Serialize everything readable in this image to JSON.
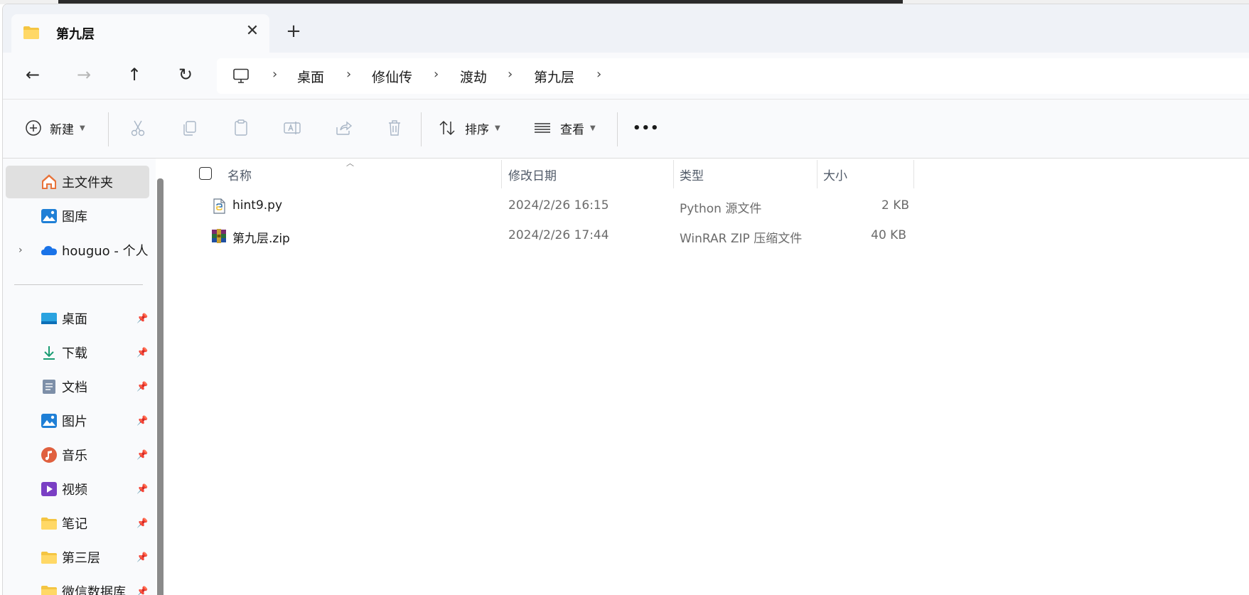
{
  "window": {
    "tab_title": "第九层",
    "new_tab": "+",
    "close": "✕"
  },
  "nav": {
    "back": "←",
    "forward": "→",
    "up": "↑",
    "refresh": "↻"
  },
  "breadcrumb": [
    "桌面",
    "修仙传",
    "渡劫",
    "第九层"
  ],
  "breadcrumb_separator": "›",
  "toolbar": {
    "new_label": "新建",
    "sort_label": "排序",
    "view_label": "查看",
    "more": "•••"
  },
  "sidebar": {
    "home": "主文件夹",
    "gallery": "图库",
    "onedrive": "houguo - 个人",
    "pinned": [
      {
        "label": "桌面",
        "icon": "desktop-icon"
      },
      {
        "label": "下载",
        "icon": "download-icon"
      },
      {
        "label": "文档",
        "icon": "document-icon"
      },
      {
        "label": "图片",
        "icon": "pictures-icon"
      },
      {
        "label": "音乐",
        "icon": "music-icon"
      },
      {
        "label": "视频",
        "icon": "video-icon"
      },
      {
        "label": "笔记",
        "icon": "folder-icon"
      },
      {
        "label": "第三层",
        "icon": "folder-icon"
      },
      {
        "label": "微信数据库",
        "icon": "folder-icon"
      }
    ]
  },
  "columns": {
    "name": "名称",
    "modified": "修改日期",
    "type": "类型",
    "size": "大小"
  },
  "files": [
    {
      "name": "hint9.py",
      "modified": "2024/2/26 16:15",
      "type": "Python 源文件",
      "size": "2 KB",
      "icon": "python-file-icon"
    },
    {
      "name": "第九层.zip",
      "modified": "2024/2/26 17:44",
      "type": "WinRAR ZIP 压缩文件",
      "size": "40 KB",
      "icon": "winrar-archive-icon"
    }
  ],
  "colors": {
    "folder": "#f4c542",
    "accent": "#0067c0",
    "titlebar": "#eff2f7",
    "selected": "#e0e0e0"
  }
}
